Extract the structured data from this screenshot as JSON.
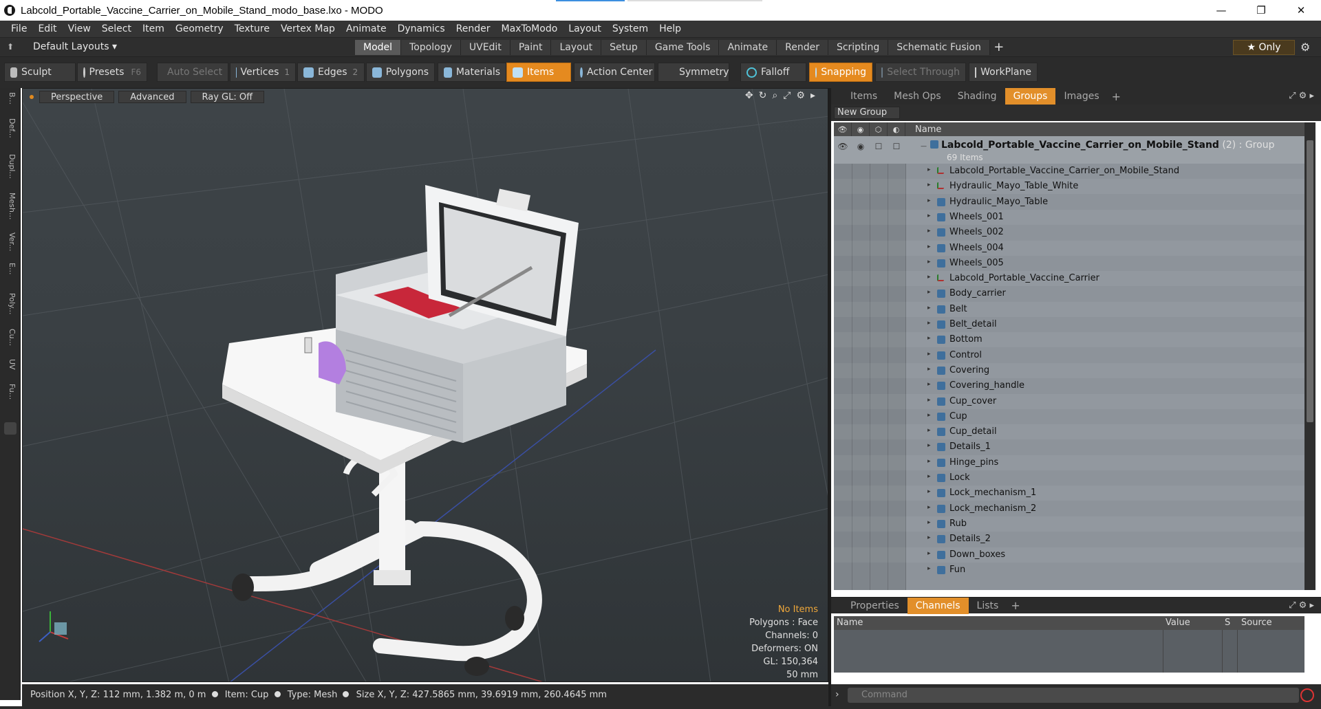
{
  "window": {
    "title": "Labcold_Portable_Vaccine_Carrier_on_Mobile_Stand_modo_base.lxo - MODO",
    "controls": [
      "—",
      "❐",
      "✕"
    ]
  },
  "menu": [
    "File",
    "Edit",
    "View",
    "Select",
    "Item",
    "Geometry",
    "Texture",
    "Vertex Map",
    "Animate",
    "Dynamics",
    "Render",
    "MaxToModo",
    "Layout",
    "System",
    "Help"
  ],
  "layout_bar": {
    "layouts_label": "Default Layouts ▾",
    "tabs": [
      "Model",
      "Topology",
      "UVEdit",
      "Paint",
      "Layout",
      "Setup",
      "Game Tools",
      "Animate",
      "Render",
      "Scripting",
      "Schematic Fusion"
    ],
    "active_tab": "Model",
    "add": "+",
    "only_label": "★ Only"
  },
  "toolbar": {
    "sculpt": "Sculpt",
    "presets": "Presets",
    "presets_key": "F6",
    "auto_select": "Auto Select",
    "vertices": "Vertices",
    "vertices_count": "1",
    "edges": "Edges",
    "edges_count": "2",
    "polygons": "Polygons",
    "materials": "Materials",
    "items": "Items",
    "action_center": "Action Center",
    "symmetry": "Symmetry",
    "falloff": "Falloff",
    "snapping": "Snapping",
    "select_through": "Select Through",
    "workplane": "WorkPlane"
  },
  "left_strip": [
    "B...",
    "Def...",
    "Dupl...",
    "Mesh...",
    "Ver...",
    "E...",
    "Poly...",
    "Cu...",
    "UV",
    "Fu..."
  ],
  "viewport": {
    "perspective": "Perspective",
    "advanced": "Advanced",
    "raygl": "Ray GL: Off",
    "info": {
      "no_items": "No Items",
      "polygons": "Polygons : Face",
      "channels": "Channels: 0",
      "deformers": "Deformers: ON",
      "gl": "GL: 150,364",
      "scale": "50 mm"
    }
  },
  "status": {
    "position_label": "Position X, Y, Z:",
    "position_value": "112 mm, 1.382 m, 0 m",
    "item_label": "Item:",
    "item_value": "Cup",
    "type_label": "Type:",
    "type_value": "Mesh",
    "size_label": "Size X, Y, Z:",
    "size_value": "427.5865 mm, 39.6919 mm, 260.4645 mm"
  },
  "right_tabs": [
    "Items",
    "Mesh Ops",
    "Shading",
    "Groups",
    "Images"
  ],
  "right_active": "Groups",
  "new_group": "New Group",
  "list_header": {
    "name": "Name"
  },
  "group": {
    "name": "Labcold_Portable_Vaccine_Carrier_on_Mobile_Stand",
    "suffix": " (2) : Group",
    "count": "69 Items"
  },
  "items": [
    {
      "label": "Labcold_Portable_Vaccine_Carrier_on_Mobile_Stand",
      "kind": "locator"
    },
    {
      "label": "Hydraulic_Mayo_Table_White",
      "kind": "locator"
    },
    {
      "label": "Hydraulic_Mayo_Table",
      "kind": "mesh"
    },
    {
      "label": "Wheels_001",
      "kind": "mesh"
    },
    {
      "label": "Wheels_002",
      "kind": "mesh"
    },
    {
      "label": "Wheels_004",
      "kind": "mesh"
    },
    {
      "label": "Wheels_005",
      "kind": "mesh"
    },
    {
      "label": "Labcold_Portable_Vaccine_Carrier",
      "kind": "locator"
    },
    {
      "label": "Body_carrier",
      "kind": "mesh"
    },
    {
      "label": "Belt",
      "kind": "mesh"
    },
    {
      "label": "Belt_detail",
      "kind": "mesh"
    },
    {
      "label": "Bottom",
      "kind": "mesh"
    },
    {
      "label": "Control",
      "kind": "mesh"
    },
    {
      "label": "Covering",
      "kind": "mesh"
    },
    {
      "label": "Covering_handle",
      "kind": "mesh"
    },
    {
      "label": "Cup_cover",
      "kind": "mesh"
    },
    {
      "label": "Cup",
      "kind": "mesh"
    },
    {
      "label": "Cup_detail",
      "kind": "mesh"
    },
    {
      "label": "Details_1",
      "kind": "mesh"
    },
    {
      "label": "Hinge_pins",
      "kind": "mesh"
    },
    {
      "label": "Lock",
      "kind": "mesh"
    },
    {
      "label": "Lock_mechanism_1",
      "kind": "mesh"
    },
    {
      "label": "Lock_mechanism_2",
      "kind": "mesh"
    },
    {
      "label": "Rub",
      "kind": "mesh"
    },
    {
      "label": "Details_2",
      "kind": "mesh"
    },
    {
      "label": "Down_boxes",
      "kind": "mesh"
    },
    {
      "label": "Fun",
      "kind": "mesh"
    }
  ],
  "channel_tabs": [
    "Properties",
    "Channels",
    "Lists"
  ],
  "channel_active": "Channels",
  "channel_header": {
    "name": "Name",
    "value": "Value",
    "s": "S",
    "source": "Source"
  },
  "command_placeholder": "Command",
  "colors": {
    "accent": "#e28f2a",
    "items_button": "#e58a1f",
    "list_bg": "#8d939a"
  }
}
